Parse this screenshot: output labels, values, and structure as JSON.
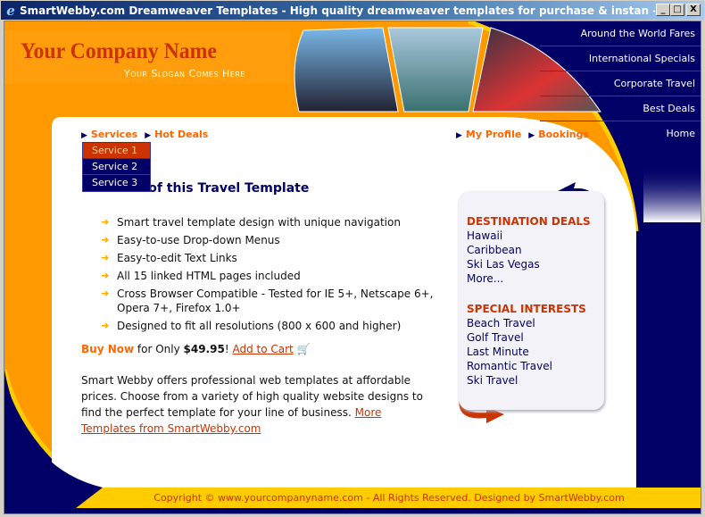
{
  "window": {
    "title": "SmartWebby.com Dreamweaver Templates - High quality dreamweaver templates for purchase & instan - Windows Interne...",
    "minimize": "_",
    "maximize": "□",
    "close": "X"
  },
  "header": {
    "company": "Your Company Name",
    "slogan": "Your Slogan Comes Here"
  },
  "right_nav": [
    "Around the World Fares",
    "International Specials",
    "Corporate Travel",
    "Best Deals",
    "Home"
  ],
  "top_menu": {
    "left": [
      "Services",
      "Hot Deals"
    ],
    "right": [
      "My Profile",
      "Bookings"
    ]
  },
  "dropdown": [
    "Service 1",
    "Service 2",
    "Service 3"
  ],
  "main": {
    "title": "Features of this Travel Template",
    "features": [
      "Smart travel template design with unique navigation",
      "Easy-to-use Drop-down Menus",
      "Easy-to-edit Text Links",
      "All 15 linked HTML pages included",
      "Cross Browser Compatible - Tested for IE 5+, Netscape 6+, Opera 7+, Firefox 1.0+",
      "Designed to fit all resolutions (800 x 600 and higher)"
    ],
    "buy_now": "Buy Now",
    "for_only": " for Only ",
    "price": "$49.95",
    "excl": "!",
    "add_to_cart": "Add to Cart",
    "paragraph": "Smart Webby offers professional web templates at affordable prices. Choose from a variety of high quality website designs to find the perfect template for your line of business. ",
    "more_link": "More Templates from SmartWebby.com"
  },
  "sidebar": {
    "deals_title": "DESTINATION DEALS",
    "deals": [
      "Hawaii",
      "Caribbean",
      "Ski Las Vegas",
      "More..."
    ],
    "interests_title": "SPECIAL INTERESTS",
    "interests": [
      "Beach Travel",
      "Golf Travel",
      "Last Minute",
      "Romantic Travel",
      "Ski Travel"
    ]
  },
  "footer": "Copyright  © www.yourcompanyname.com - All Rights Reserved. Designed by SmartWebby.com",
  "colors": {
    "orange": "#ff9900",
    "navy": "#000066",
    "yellow": "#ffcc00",
    "red": "#cc3300"
  }
}
